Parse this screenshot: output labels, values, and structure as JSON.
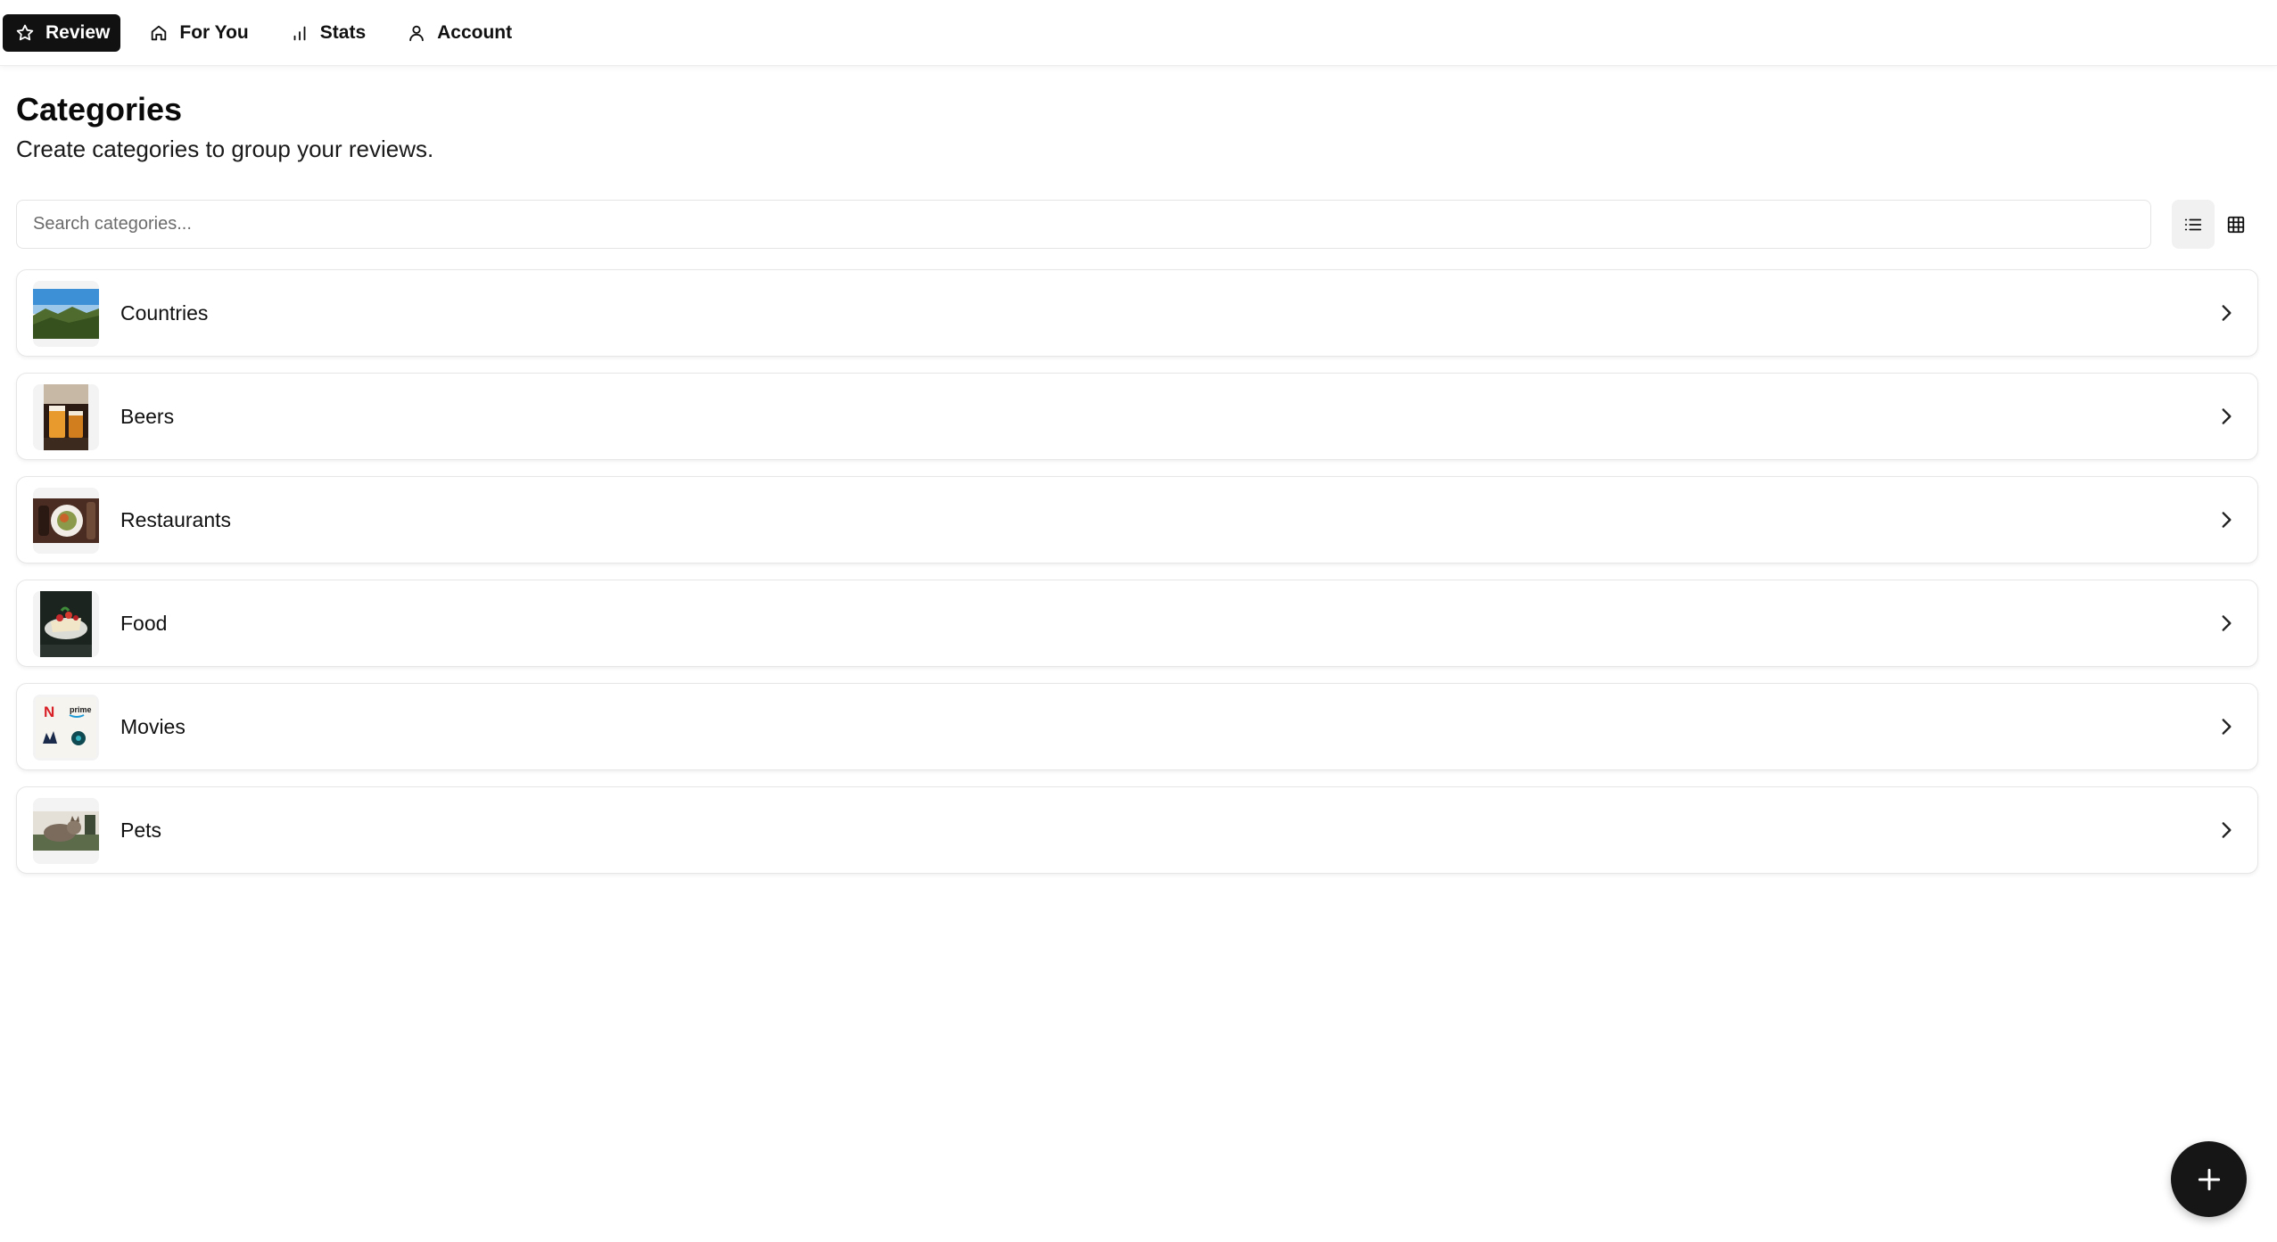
{
  "nav": {
    "items": [
      {
        "label": "Review",
        "icon": "star-icon",
        "active": true
      },
      {
        "label": "For You",
        "icon": "home-icon",
        "active": false
      },
      {
        "label": "Stats",
        "icon": "bar-chart-icon",
        "active": false
      },
      {
        "label": "Account",
        "icon": "user-icon",
        "active": false
      }
    ]
  },
  "page": {
    "title": "Categories",
    "subtitle": "Create categories to group your reviews."
  },
  "search": {
    "placeholder": "Search categories...",
    "value": ""
  },
  "view_toggle": {
    "options": [
      "list-view-icon",
      "grid-view-icon"
    ],
    "selected": "list"
  },
  "categories": [
    {
      "label": "Countries",
      "thumbnail": "landscape-photo"
    },
    {
      "label": "Beers",
      "thumbnail": "beer-photo"
    },
    {
      "label": "Restaurants",
      "thumbnail": "restaurant-photo"
    },
    {
      "label": "Food",
      "thumbnail": "food-photo"
    },
    {
      "label": "Movies",
      "thumbnail": "streaming-logos"
    },
    {
      "label": "Pets",
      "thumbnail": "pet-photo"
    }
  ],
  "thumbnail_text": {
    "netflix": "N",
    "prime": "prime"
  },
  "fab": {
    "icon": "plus-icon"
  },
  "colors": {
    "primary": "#111111",
    "border": "#e6e6e6",
    "muted_text": "#6b6b6b"
  }
}
